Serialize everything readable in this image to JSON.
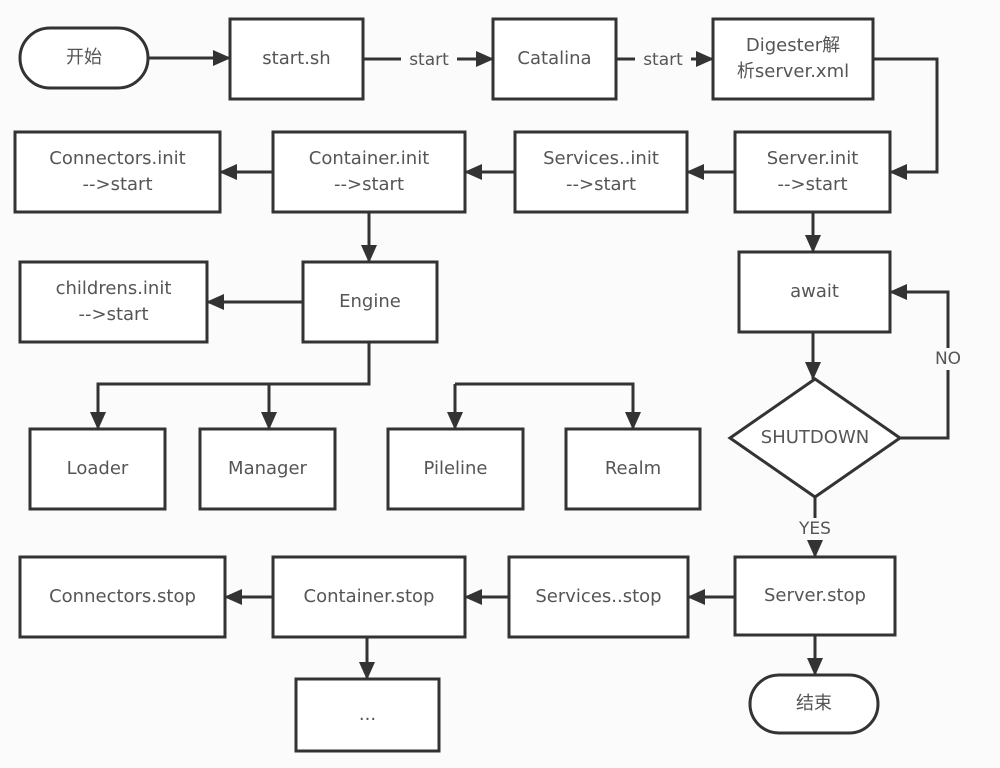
{
  "diagram": {
    "type": "flowchart",
    "nodes": {
      "start": {
        "shape": "terminal",
        "lines": [
          "开始"
        ]
      },
      "start_sh": {
        "shape": "process",
        "lines": [
          "start.sh"
        ]
      },
      "catalina": {
        "shape": "process",
        "lines": [
          "Catalina"
        ]
      },
      "digester": {
        "shape": "process",
        "lines": [
          "Digester解",
          "析server.xml"
        ]
      },
      "server_init": {
        "shape": "process",
        "lines": [
          "Server.init",
          "-->start"
        ]
      },
      "services_init": {
        "shape": "process",
        "lines": [
          "Services..init",
          "-->start"
        ]
      },
      "container_init": {
        "shape": "process",
        "lines": [
          "Container.init",
          "-->start"
        ]
      },
      "connectors_init": {
        "shape": "process",
        "lines": [
          "Connectors.init",
          "-->start"
        ]
      },
      "engine": {
        "shape": "process",
        "lines": [
          "Engine"
        ]
      },
      "childrens_init": {
        "shape": "process",
        "lines": [
          "childrens.init",
          "-->start"
        ]
      },
      "loader": {
        "shape": "process",
        "lines": [
          "Loader"
        ]
      },
      "manager": {
        "shape": "process",
        "lines": [
          "Manager"
        ]
      },
      "pileline": {
        "shape": "process",
        "lines": [
          "Pileline"
        ]
      },
      "realm": {
        "shape": "process",
        "lines": [
          "Realm"
        ]
      },
      "await": {
        "shape": "process",
        "lines": [
          "await"
        ]
      },
      "shutdown": {
        "shape": "decision",
        "lines": [
          "SHUTDOWN"
        ]
      },
      "server_stop": {
        "shape": "process",
        "lines": [
          "Server.stop"
        ]
      },
      "services_stop": {
        "shape": "process",
        "lines": [
          "Services..stop"
        ]
      },
      "container_stop": {
        "shape": "process",
        "lines": [
          "Container.stop"
        ]
      },
      "connectors_stop": {
        "shape": "process",
        "lines": [
          "Connectors.stop"
        ]
      },
      "ellipsis": {
        "shape": "process",
        "lines": [
          "..."
        ]
      },
      "end": {
        "shape": "terminal",
        "lines": [
          "结束"
        ]
      }
    },
    "edges": [
      {
        "from": "start",
        "to": "start_sh",
        "label": ""
      },
      {
        "from": "start_sh",
        "to": "catalina",
        "label": "start"
      },
      {
        "from": "catalina",
        "to": "digester",
        "label": "start"
      },
      {
        "from": "digester",
        "to": "server_init",
        "label": ""
      },
      {
        "from": "server_init",
        "to": "services_init",
        "label": ""
      },
      {
        "from": "services_init",
        "to": "container_init",
        "label": ""
      },
      {
        "from": "container_init",
        "to": "connectors_init",
        "label": ""
      },
      {
        "from": "container_init",
        "to": "engine",
        "label": ""
      },
      {
        "from": "engine",
        "to": "childrens_init",
        "label": ""
      },
      {
        "from": "engine",
        "to": "loader",
        "label": ""
      },
      {
        "from": "engine",
        "to": "manager",
        "label": ""
      },
      {
        "from": "engine",
        "to": "pileline",
        "label": ""
      },
      {
        "from": "engine",
        "to": "realm",
        "label": ""
      },
      {
        "from": "server_init",
        "to": "await",
        "label": ""
      },
      {
        "from": "await",
        "to": "shutdown",
        "label": ""
      },
      {
        "from": "shutdown",
        "to": "await",
        "label": "NO"
      },
      {
        "from": "shutdown",
        "to": "server_stop",
        "label": "YES"
      },
      {
        "from": "server_stop",
        "to": "services_stop",
        "label": ""
      },
      {
        "from": "services_stop",
        "to": "container_stop",
        "label": ""
      },
      {
        "from": "container_stop",
        "to": "connectors_stop",
        "label": ""
      },
      {
        "from": "container_stop",
        "to": "ellipsis",
        "label": ""
      },
      {
        "from": "server_stop",
        "to": "end",
        "label": ""
      }
    ]
  }
}
